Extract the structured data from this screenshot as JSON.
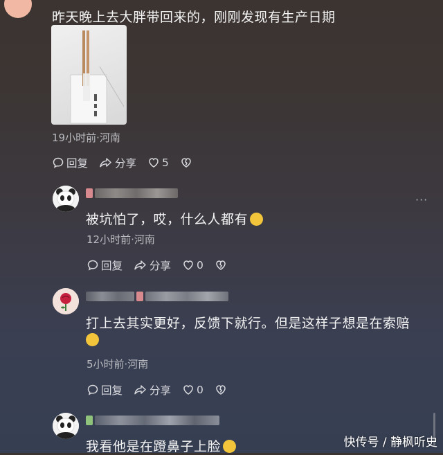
{
  "post": {
    "text": "昨天晚上去大胖带回来的，刚刚发现有生产日期",
    "meta": "19小时前·河南",
    "reply_label": "回复",
    "share_label": "分享",
    "like_count": "5"
  },
  "comments": [
    {
      "text": "被坑怕了，哎，什么人都有",
      "meta": "12小时前·河南",
      "reply_label": "回复",
      "share_label": "分享",
      "like_count": "0",
      "avatar": "panda-avatar",
      "emoji": "thinking-emoji"
    },
    {
      "text_line1": "打上去其实更好，反馈下就行。但是这样子想是在索赔",
      "meta": "5小时前·河南",
      "reply_label": "回复",
      "share_label": "分享",
      "like_count": "0",
      "avatar": "rose-avatar",
      "emoji": "laugh-cry-emoji"
    },
    {
      "text": "我看他是在蹬鼻子上脸",
      "avatar": "panda-avatar",
      "emoji": "grinning-emoji"
    }
  ],
  "watermark": "快传号 / 静枫听史",
  "more_icon": "ellipsis-icon"
}
